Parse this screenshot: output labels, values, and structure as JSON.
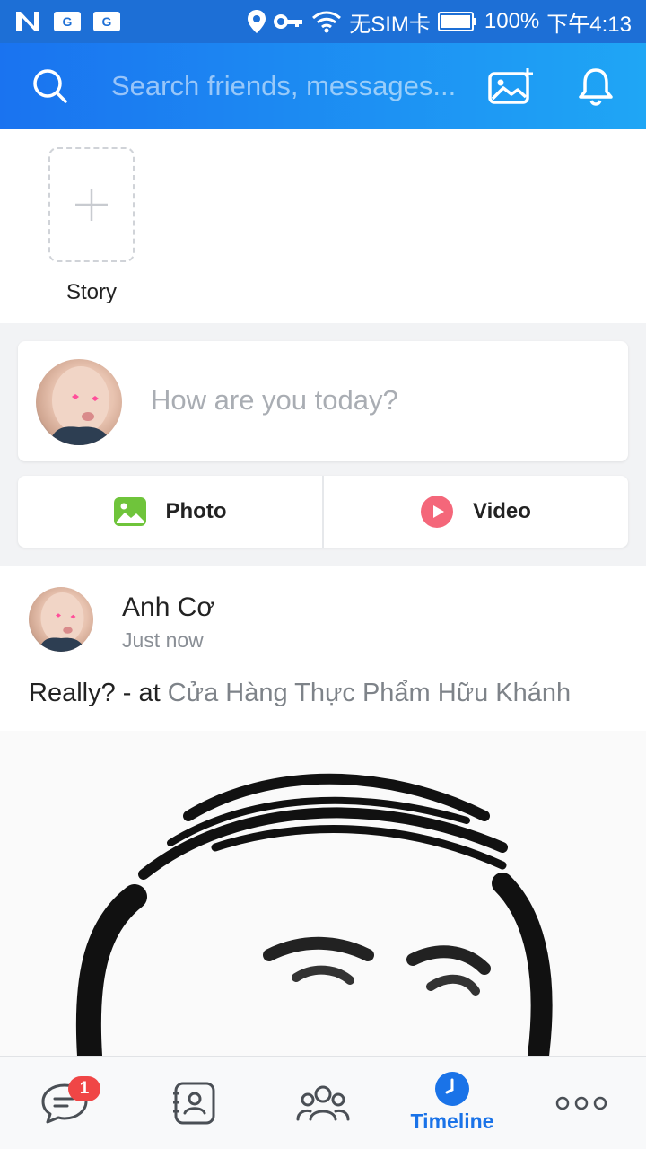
{
  "status_bar": {
    "carrier": "无SIM卡",
    "battery": "100%",
    "time": "下午4:13",
    "badge1": "G",
    "badge2": "G"
  },
  "header": {
    "search_placeholder": "Search friends, messages..."
  },
  "stories": {
    "add_label": "Story"
  },
  "compose": {
    "placeholder": "How are you today?",
    "photo_label": "Photo",
    "video_label": "Video"
  },
  "post": {
    "author": "Anh Cơ",
    "time": "Just now",
    "text": "Really? - at ",
    "place": "Cửa Hàng Thực Phẩm Hữu Khánh"
  },
  "bottom_nav": {
    "messages_badge": "1",
    "timeline_label": "Timeline"
  },
  "colors": {
    "header_start": "#1a73f0",
    "header_end": "#1fa6f5",
    "accent": "#1a73e8",
    "badge": "#f04646"
  }
}
